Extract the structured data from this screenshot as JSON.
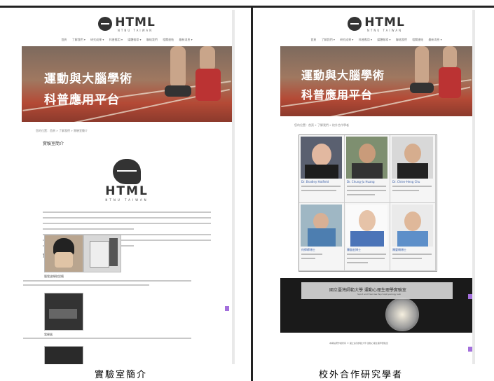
{
  "site": {
    "logo_text": "HTML",
    "logo_sub": "NTNU TAIWAN",
    "nav": [
      "首頁",
      "了解我們 ▾",
      "研究成果 ▾",
      "科普應用 ▾",
      "媒體報導 ▾",
      "聯絡我們",
      "相關連結",
      "最新消息 ▾"
    ],
    "banner_line1": "運動與大腦學術",
    "banner_line2": "科普應用平台"
  },
  "left_page": {
    "breadcrumb": "您的位置：首頁 » 了解我們 » 實驗室簡介",
    "title": "實驗室簡介",
    "big_logo_text": "HTML",
    "big_logo_sub": "NTNU TAIWAN",
    "subsection": "實驗設備",
    "equipment_label_1": "腦電波擷取設備",
    "equipment_label_2": "電擊器"
  },
  "right_page": {
    "breadcrumb": "您的位置：首頁 » 了解我們 » 校外合作學者",
    "title": "校外合作學者",
    "scholars": [
      {
        "name": "Dr. Bradley Hatfield"
      },
      {
        "name": "Dr. Chung-Ju Huang"
      },
      {
        "name": "Dr. Chien-Heng Chu"
      },
      {
        "name": "何律師博士"
      },
      {
        "name": "陳殷宏博士"
      },
      {
        "name": "陳晏碩博士"
      }
    ],
    "footer_banner_title": "國立臺灣師範大學 運動心理生理學實驗室",
    "footer_banner_sub": "Sport and Exercise Psychophysiology Lab",
    "footer_text": "本網站著作權所有 © 國立臺灣師範大學 運動心理生理學實驗室"
  },
  "captions": {
    "left": "實驗室簡介",
    "right": "校外合作研究學者"
  },
  "colors": {
    "accent_purple": "#a36fdc",
    "link_blue": "#3a5fa8"
  }
}
